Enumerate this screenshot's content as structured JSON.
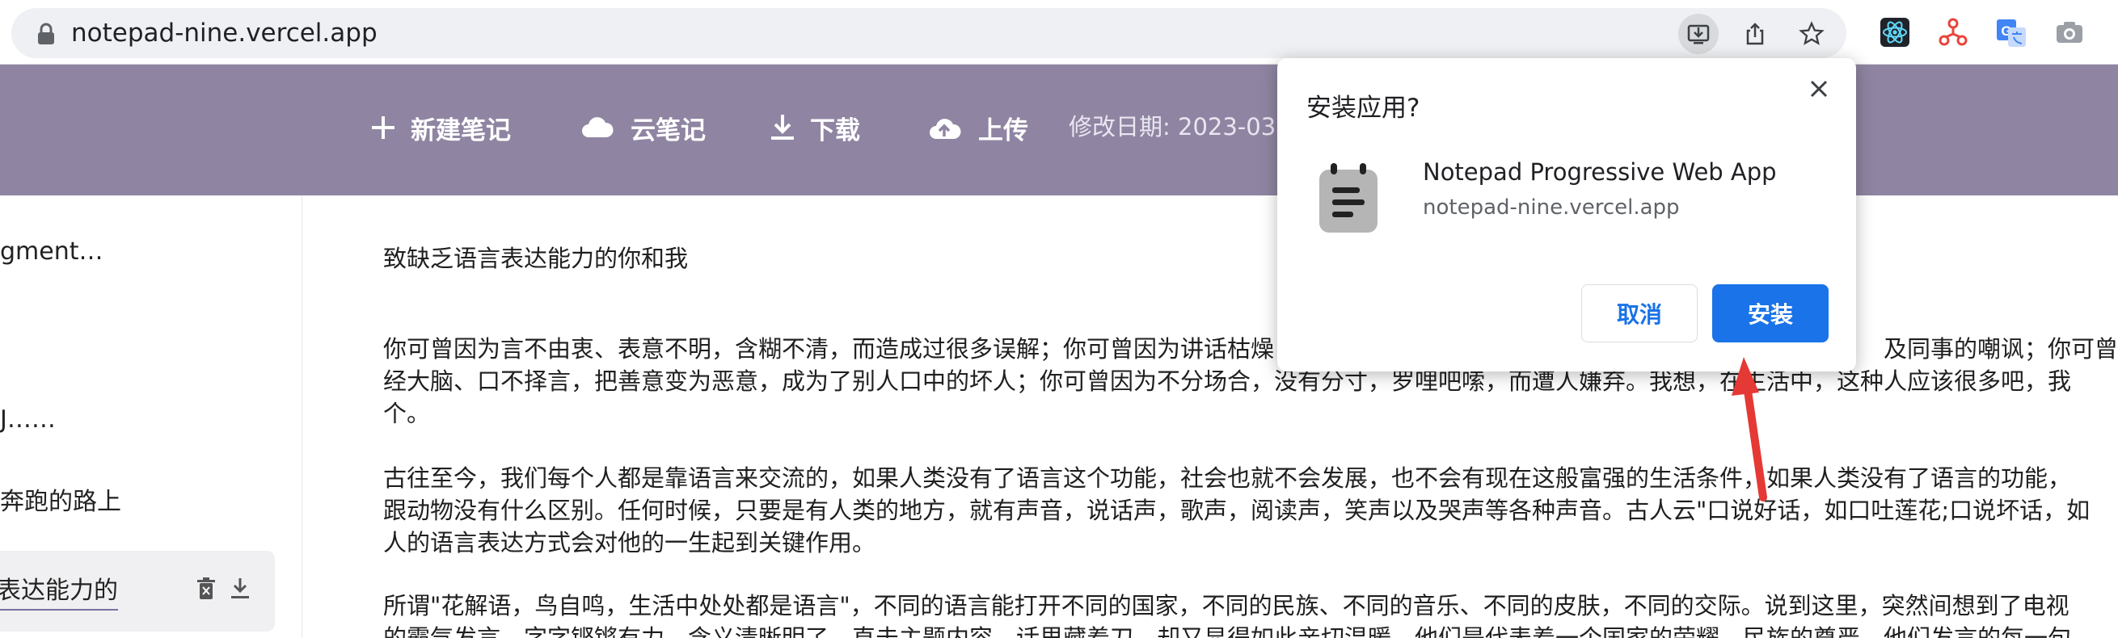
{
  "browser": {
    "url": "notepad-nine.vercel.app",
    "omnibox_icons": [
      "install-app-icon",
      "share-icon",
      "bookmark-star-icon"
    ],
    "extensions": [
      "react-devtools-icon",
      "network-extension-icon",
      "translate-extension-icon",
      "camera-extension-icon"
    ]
  },
  "header": {
    "new_note": "新建笔记",
    "cloud_notes": "云笔记",
    "download": "下载",
    "upload": "上传",
    "modified_date": "修改日期: 2023-03"
  },
  "sidebar": {
    "items": [
      {
        "label": "gment…"
      },
      {
        "label": "J……"
      },
      {
        "label": "奔跑的路上"
      },
      {
        "label": "表达能力的你"
      }
    ]
  },
  "document": {
    "title": "致缺乏语言表达能力的你和我",
    "paragraphs": [
      [
        "你可曾因为言不由衷、表意不明，含糊不清，而造成过很多误解；你可曾因为讲话枯燥",
        "及同事的嘲讽；你可曾因",
        "经大脑、口不择言，把善意变为恶意，成为了别人口中的坏人；你可曾因为不分场合，没有分寸，罗哩吧嗦，而遭人嫌弃。我想，在生活中，这种人应该很多吧，我",
        "个。"
      ],
      [
        "古往至今，我们每个人都是靠语言来交流的，如果人类没有了语言这个功能，社会也就不会发展，也不会有现在这般富强的生活条件，如果人类没有了语言的功能，",
        "跟动物没有什么区别。任何时候，只要是有人类的地方，就有声音，说话声，歌声，阅读声，笑声以及哭声等各种声音。古人云\"口说好话，如口吐莲花;口说坏话，如",
        "人的语言表达方式会对他的一生起到关键作用。"
      ],
      [
        "所谓\"花解语，鸟自鸣，生活中处处都是语言\"，不同的语言能打开不同的国家，不同的民族、不同的音乐、不同的皮肤，不同的交际。说到这里，突然间想到了电视",
        "的霸气发言，字字铿锵有力，含义清晰明了，直击主题内容，话里藏着刀，却又显得如此亲切温暖。他们是代表着一个国家的荣耀、民族的尊严，他们发言的每一句"
      ]
    ]
  },
  "popup": {
    "title": "安装应用?",
    "app_name": "Notepad Progressive Web App",
    "app_url": "notepad-nine.vercel.app",
    "cancel": "取消",
    "install": "安装"
  },
  "colors": {
    "header_bg": "#8f85a2",
    "install_button": "#1a73e8",
    "annotation_arrow": "#e53935"
  }
}
